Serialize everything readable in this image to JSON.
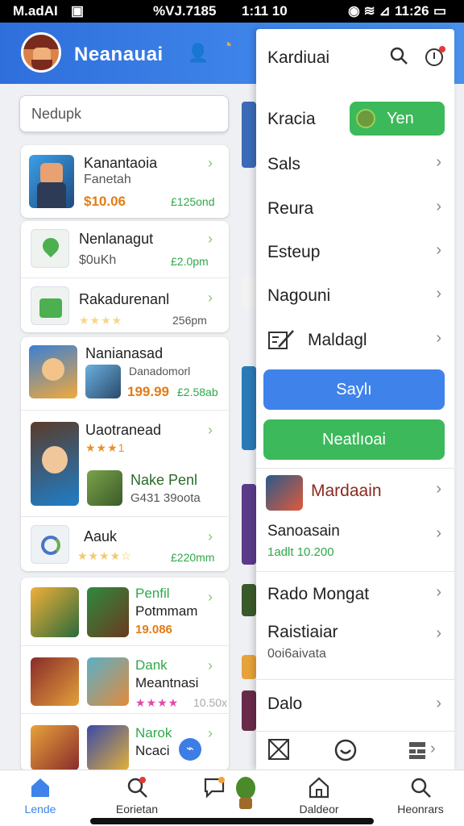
{
  "status_bar": {
    "left": "M.adAI",
    "center": "%VJ.7185",
    "center2": "1:11 10",
    "right": "11:26"
  },
  "header": {
    "title": "Neanauai"
  },
  "search": {
    "placeholder": "Nedupk"
  },
  "list": {
    "card1": {
      "title": "Kanantaoia",
      "subtitle": "Fanetah",
      "price": "$10.06",
      "meta": "£125ond"
    },
    "card2": [
      {
        "title": "Nenlanagut",
        "subtitle": "$0uKh",
        "meta": "£2.0pm"
      },
      {
        "title": "Rakadurenanl",
        "meta": "256pm"
      }
    ],
    "card3": [
      {
        "title": "Nanianasad",
        "sub_title": "Danadomorl",
        "price": "199.99",
        "meta": "£2.58ab"
      },
      {
        "title": "Uaotranead",
        "rating": "★★★1",
        "sub_title": "Nake Penl",
        "meta": "G431 39oota"
      },
      {
        "title": "Aauk",
        "meta": "£220mm"
      }
    ],
    "card4": [
      {
        "title": "Penfil",
        "subtitle": "Potmmam",
        "price": "19.086"
      },
      {
        "title": "Dank",
        "subtitle": "Meantnasi",
        "meta": "10.50x"
      },
      {
        "title": "Narok",
        "subtitle": "Ncaci"
      }
    ]
  },
  "panel": {
    "title": "Kardiuai",
    "toggle_row": {
      "label": "Kracia",
      "toggle_label": "Yen"
    },
    "menu": [
      "Sals",
      "Reura",
      "Esteup",
      "Nagouni",
      "Maldagl"
    ],
    "primary_button": "Saylı",
    "secondary_button": "Neatlıoai",
    "items": [
      {
        "label": "Mardaain"
      },
      {
        "label": "Sanoasain",
        "sub": "1adlt 10.200"
      },
      {
        "label": "Rado Mongat"
      },
      {
        "label": "Raistiaiar",
        "sub": "0oi6aivata"
      },
      {
        "label": "Dalo"
      }
    ]
  },
  "bottom_nav": [
    {
      "label": "Lende",
      "icon": "home-icon",
      "active": true
    },
    {
      "label": "Eorietan",
      "icon": "search-icon"
    },
    {
      "label": "",
      "icon": "chat-icon"
    },
    {
      "label": "Daldeor",
      "icon": "home-outline-icon"
    },
    {
      "label": "Heonrars",
      "icon": "search-icon"
    }
  ],
  "colors": {
    "header": "#3a7de3",
    "primary": "#3f83ea",
    "green": "#3cb95a",
    "price": "#e27c14"
  }
}
